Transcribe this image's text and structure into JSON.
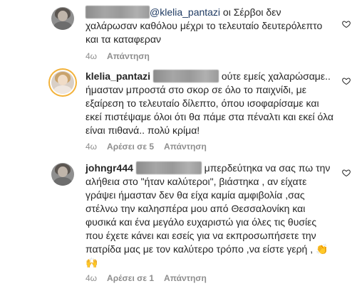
{
  "comments": [
    {
      "user": "",
      "mention": "@klelia_pantazi",
      "text": " οι Σέρβοι δεν χαλάρωσαν καθόλου μέχρι το τελευταίο δευτερόλεπτο και τα καταφεραν",
      "time": "4ω",
      "likes": "",
      "reply": "Απάντηση"
    },
    {
      "user": "klelia_pantazi",
      "mention": "",
      "text": " ούτε εμείς χαλαρώσαμε.. ήμασταν μπροστά στο σκορ σε όλο το παιχνίδι, με εξαίρεση το τελευταίο δίλεπτο, όπου ισοφαρίσαμε και εκεί πιστέψαμε όλοι ότι θα πάμε στα πέναλτι και εκεί όλα είναι πιθανά.. πολύ κρίμα!",
      "time": "4ω",
      "likes": "Αρέσει σε 5",
      "reply": "Απάντηση"
    },
    {
      "user": "johngr444",
      "mention": "",
      "text": " μπερδεύτηκα να σας πω την αλήθεια στο \"ήταν καλύτεροι\", βιάστηκα , αν είχατε γράψει ήμασταν δεν θα είχα καμία αμφιβολία ,σας στέλνω την καλησπέρα μου από Θεσσαλονίκη και φυσικά και ένα μεγάλο ευχαριστώ για όλες τις θυσίες που έχετε κάνει και εσείς για να εκπροσωπήσετε την πατρίδα μας με τον καλύτερο τρόπο ,να είστε γερή ,",
      "emoji": "👏🙌",
      "time": "4ω",
      "likes": "Αρέσει σε 1",
      "reply": "Απάντηση"
    }
  ],
  "icons": {
    "like": "heart-outline-icon"
  }
}
